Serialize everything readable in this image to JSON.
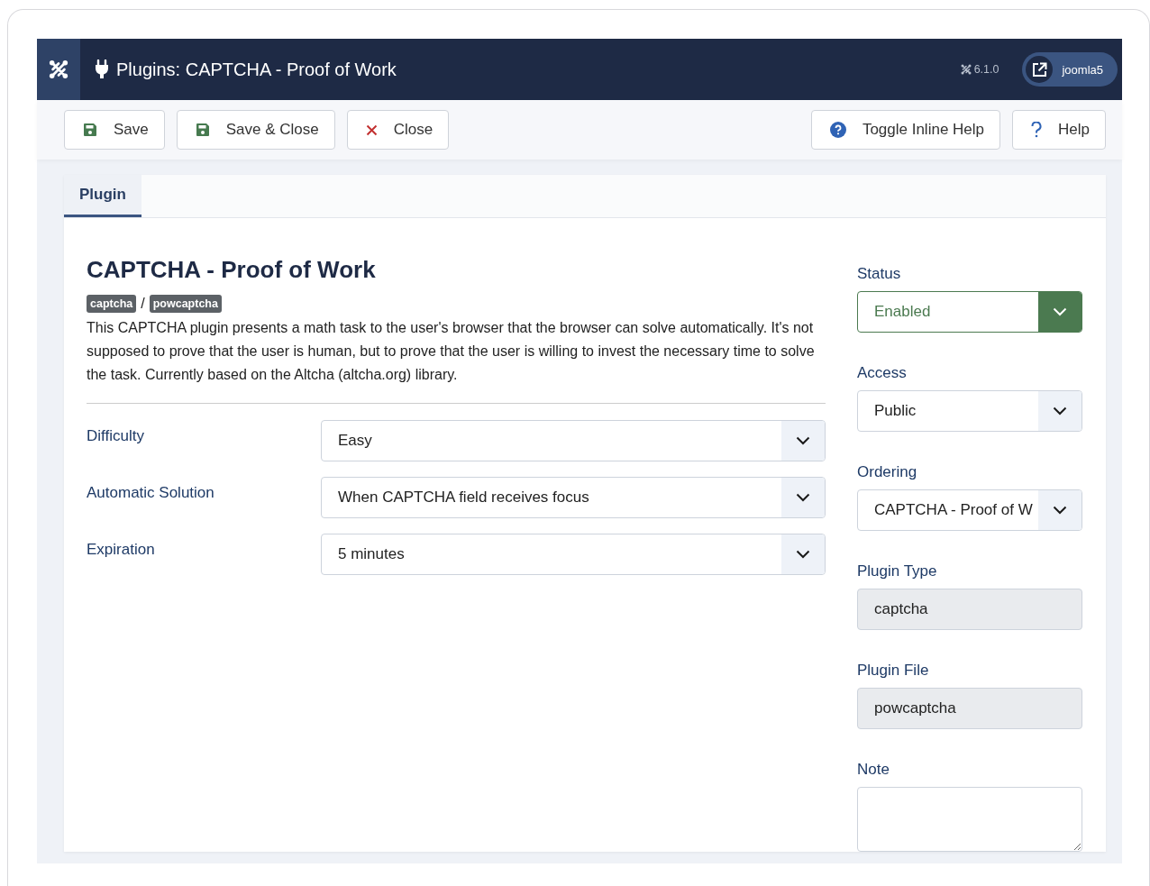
{
  "header": {
    "title": "Plugins: CAPTCHA - Proof of Work",
    "version": "6.1.0",
    "user": "joomla5"
  },
  "toolbar": {
    "left": [
      {
        "label": "Save",
        "kind": "save"
      },
      {
        "label": "Save & Close",
        "kind": "save"
      },
      {
        "label": "Close",
        "kind": "close"
      }
    ],
    "right": [
      {
        "label": "Toggle Inline Help",
        "kind": "help-circle"
      },
      {
        "label": "Help",
        "kind": "help"
      }
    ]
  },
  "tabs": [
    {
      "label": "Plugin",
      "selected": true
    }
  ],
  "plugin": {
    "title": "CAPTCHA - Proof of Work",
    "folder": "captcha",
    "separator": "/",
    "element": "powcaptcha",
    "description": "This CAPTCHA plugin presents a math task to the user's browser that the browser can solve automatically. It's not supposed to prove that the user is human, but to prove that the user is willing to invest the necessary time to solve the task. Currently based on the Altcha (altcha.org) library."
  },
  "options": [
    {
      "label": "Difficulty",
      "value": "Easy"
    },
    {
      "label": "Automatic Solution",
      "value": "When CAPTCHA field receives focus"
    },
    {
      "label": "Expiration",
      "value": "5 minutes"
    }
  ],
  "sidebar": [
    {
      "label": "Status",
      "kind": "status-select",
      "value": "Enabled"
    },
    {
      "label": "Access",
      "kind": "select",
      "value": "Public"
    },
    {
      "label": "Ordering",
      "kind": "select",
      "value": "CAPTCHA - Proof of W"
    },
    {
      "label": "Plugin Type",
      "kind": "readonly",
      "value": "captcha"
    },
    {
      "label": "Plugin File",
      "kind": "readonly",
      "value": "powcaptcha"
    },
    {
      "label": "Note",
      "kind": "textarea"
    }
  ]
}
